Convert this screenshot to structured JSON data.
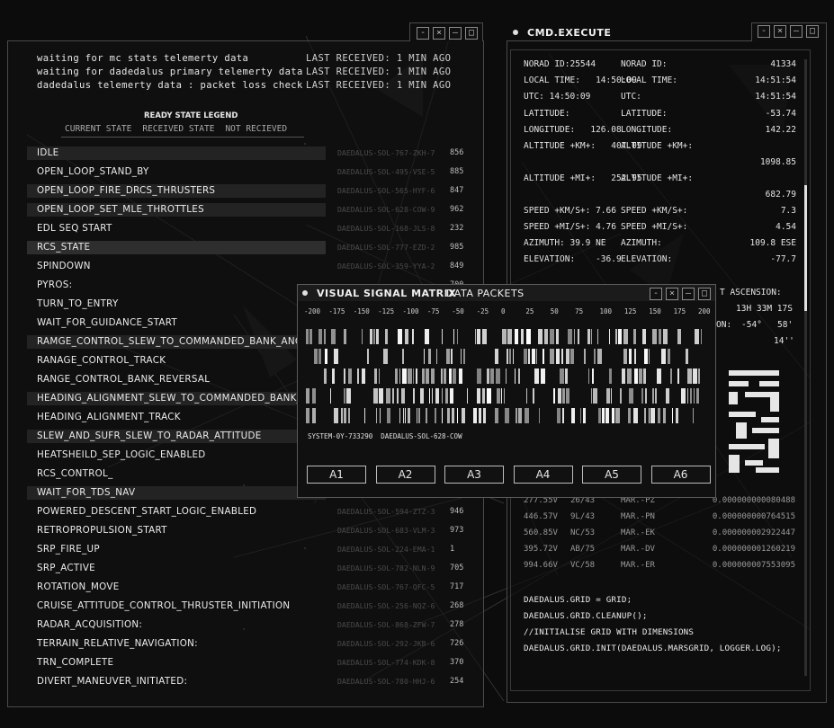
{
  "left_panel": {
    "telemetry": [
      {
        "text": "waiting for mc stats telemerty data",
        "status": "LAST RECEIVED: 1 MIN AGO"
      },
      {
        "text": "waiting for dadedalus primary telemerty data",
        "status": "LAST RECEIVED: 1 MIN AGO"
      },
      {
        "text": "dadedalus telemerty data : packet loss check",
        "status": "LAST RECEIVED: 1 MIN AGO"
      }
    ],
    "legend": {
      "title": "READY STATE LEGEND",
      "items": [
        "CURRENT STATE",
        "RECEIVED STATE",
        "NOT RECIEVED"
      ]
    },
    "states": [
      {
        "label": "IDLE",
        "code": "DAEDALUS-SOL-767-ZKH-7",
        "num": "856"
      },
      {
        "label": "OPEN_LOOP_STAND_BY",
        "code": "DAEDALUS-SOL-495-VSE-5",
        "num": "885"
      },
      {
        "label": "OPEN_LOOP_FIRE_DRCS_THRUSTERS",
        "code": "DAEDALUS-SOL-565-HYF-6",
        "num": "847"
      },
      {
        "label": "OPEN_LOOP_SET_MLE_THROTTLES",
        "code": "DAEDALUS-SOL-628-COW-9",
        "num": "962"
      },
      {
        "label": "EDL SEQ START",
        "code": "DAEDALUS-SOL-168-JLS-8",
        "num": "232"
      },
      {
        "label": "RCS_STATE",
        "code": "DAEDALUS-SOL-777-EZD-2",
        "num": "985"
      },
      {
        "label": "SPINDOWN",
        "code": "DAEDALUS-SOL-359-YYA-2",
        "num": "849"
      },
      {
        "label": "PYROS:",
        "code": "",
        "num": "700"
      },
      {
        "label": "TURN_TO_ENTRY",
        "code": "",
        "num": ""
      },
      {
        "label": "WAIT_FOR_GUIDANCE_START",
        "code": "",
        "num": ""
      },
      {
        "label": "RAMGE_CONTROL_SLEW_TO_COMMANDED_BANK_ANGLE",
        "code": "",
        "num": ""
      },
      {
        "label": "RANAGE_CONTROL_TRACK",
        "code": "",
        "num": ""
      },
      {
        "label": "RANGE_CONTROL_BANK_REVERSAL",
        "code": "",
        "num": ""
      },
      {
        "label": "HEADING_ALIGNMENT_SLEW_TO_COMMANDED_BANK_ANGLE",
        "code": "",
        "num": ""
      },
      {
        "label": "HEADING_ALIGNMENT_TRACK",
        "code": "",
        "num": ""
      },
      {
        "label": "SLEW_AND_SUFR_SLEW_TO_RADAR_ATTITUDE",
        "code": "",
        "num": ""
      },
      {
        "label": "HEATSHEILD_SEP_LOGIC_ENABLED",
        "code": "",
        "num": ""
      },
      {
        "label": "RCS_CONTROL_",
        "code": "",
        "num": ""
      },
      {
        "label": "WAIT_FOR_TDS_NAV",
        "code": "",
        "num": ""
      },
      {
        "label": "POWERED_DESCENT_START_LOGIC_ENABLED",
        "code": "DAEDALUS-SOL-594-ZTZ-3",
        "num": "946"
      },
      {
        "label": "RETROPROPULSION_START",
        "code": "DAEDALUS-SOL-683-VLM-3",
        "num": "973"
      },
      {
        "label": "SRP_FIRE_UP",
        "code": "DAEDALUS-SOL-224-EMA-1",
        "num": "1"
      },
      {
        "label": "SRP_ACTIVE",
        "code": "DAEDALUS-SOL-782-NLN-9",
        "num": "705"
      },
      {
        "label": "ROTATION_MOVE",
        "code": "DAEDALUS-SOL-767-QFC-5",
        "num": "717"
      },
      {
        "label": "CRUISE_ATTITUDE_CONTROL_THRUSTER_INITIATION",
        "code": "DAEDALUS-SOL-256-NQZ-6",
        "num": "268"
      },
      {
        "label": "RADAR_ACQUISITION:",
        "code": "DAEDALUS-SOL-868-ZFW-7",
        "num": "278"
      },
      {
        "label": "TERRAIN_RELATIVE_NAVIGATION:",
        "code": "DAEDALUS-SOL-292-JKB-6",
        "num": "726"
      },
      {
        "label": "TRN_COMPLETE",
        "code": "DAEDALUS-SOL-774-KDK-8",
        "num": "370"
      },
      {
        "label": "DIVERT_MANEUVER_INITIATED:",
        "code": "DAEDALUS-SOL-780-HHJ-6",
        "num": "254"
      }
    ]
  },
  "cmd_panel": {
    "title": "CMD.EXECUTE",
    "nav": [
      {
        "l": "NORAD ID:25544",
        "m": "NORAD ID:",
        "r": "41334"
      },
      {
        "l": "LOCAL TIME:   14:50:09",
        "m": "LOCAL TIME:",
        "r": "14:51:54"
      },
      {
        "l": "UTC: 14:50:09",
        "m": "UTC:",
        "r": "14:51:54"
      },
      {
        "l": "LATITUDE:",
        "m": "LATITUDE:",
        "r": "-53.74"
      },
      {
        "l": "LONGITUDE:   126.08",
        "m": "LONGITUDE:",
        "r": "142.22"
      },
      {
        "l": "ALTITUDE +KM+:   407.09",
        "m": "ALTITUDE +KM+:",
        "r": ""
      },
      {
        "l": "",
        "m": "",
        "r": "1098.85"
      },
      {
        "l": "ALTITUDE +MI+:   252.95",
        "m": "ALTITUDE +MI+:",
        "r": ""
      },
      {
        "l": "",
        "m": "",
        "r": "682.79"
      },
      {
        "l": "SPEED +KM/S+: 7.66",
        "m": "SPEED +KM/S+:",
        "r": "7.3"
      },
      {
        "l": "SPEED +MI/S+: 4.76",
        "m": "SPEED +MI/S+:",
        "r": "4.54"
      },
      {
        "l": "AZIMUTH: 39.9 NE",
        "m": "AZIMUTH:",
        "r": "109.8 ESE"
      },
      {
        "l": "ELEVATION:    -36.9",
        "m": "ELEVATION:",
        "r": "-77.7"
      }
    ],
    "ascension_label": "T ASCENSION:",
    "ascension_value": "13H 33M 17S",
    "declination_label": "ON:",
    "declination_value": "-54°   58'",
    "dec_seconds": "14''",
    "table": [
      [
        "277.55V",
        "26/43",
        "MAR.-PZ",
        "0.000000000080488"
      ],
      [
        "446.57V",
        "9L/43",
        "MAR.-PN",
        "0.000000000764515"
      ],
      [
        "560.85V",
        "NC/53",
        "MAR.-EK",
        "0.000000002922447"
      ],
      [
        "395.72V",
        "AB/75",
        "MAR.-DV",
        "0.000000001260219"
      ],
      [
        "994.66V",
        "VC/58",
        "MAR.-ER",
        "0.000000007553095"
      ]
    ],
    "code": [
      "DAEDALUS.GRID = GRID;",
      "DAEDALUS.GRID.CLEANUP();",
      "//INITIALISE GRID WITH DIMENSIONS",
      "DAEDALUS.GRID.INIT(DAEDALUS.MARSGRID, LOGGER.LOG);"
    ]
  },
  "signal_panel": {
    "title": "VISUAL SIGNAL MATRIX",
    "subtitle": "DATA PACKETS",
    "axis": [
      "-200",
      "-175",
      "-150",
      "-125",
      "-100",
      "-75",
      "-50",
      "-25",
      "0",
      "25",
      "50",
      "75",
      "100",
      "125",
      "150",
      "175",
      "200"
    ],
    "system_id": "SYSTEM-0Y-733290  DAEDALUS-SOL-628-COW",
    "buttons": [
      "A1",
      "A2",
      "A3",
      "A4",
      "A5",
      "A6"
    ]
  },
  "window_buttons": [
    "-",
    "×",
    "–",
    "□"
  ]
}
